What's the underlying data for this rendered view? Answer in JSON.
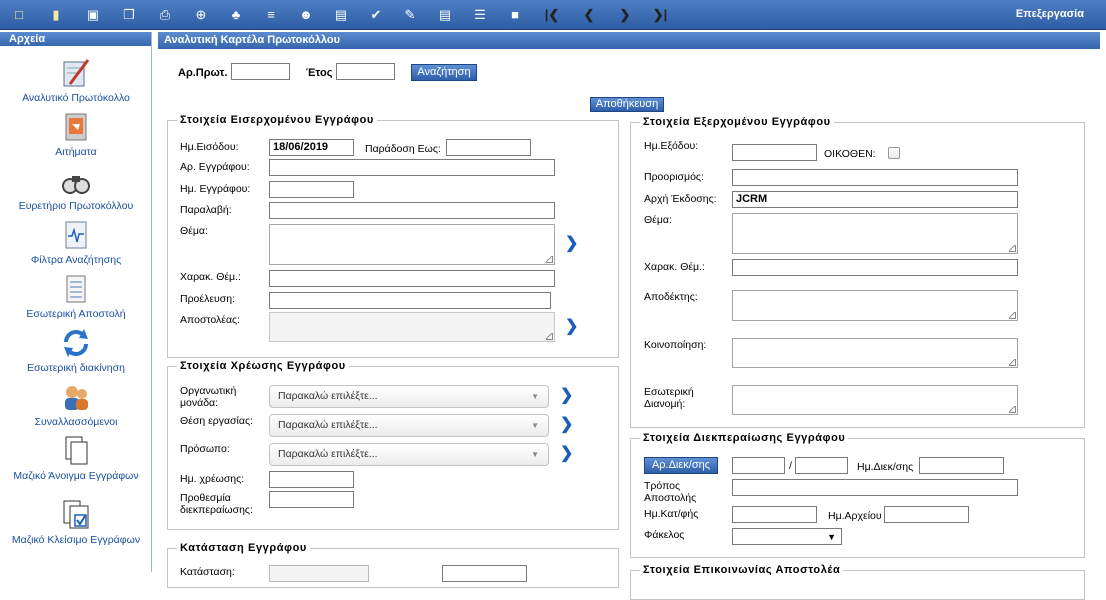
{
  "toolbar": {
    "title": "Επεξεργασία",
    "icons": [
      "new-document-icon",
      "open-folder-icon",
      "save-icon",
      "copy-icon",
      "paste-icon",
      "add-icon",
      "stamp-icon",
      "tree-icon",
      "users-icon",
      "clipboard-icon",
      "check-icon",
      "edit-icon",
      "stack-icon",
      "list-icon",
      "archive-box-icon",
      "first-page-icon",
      "previous-icon",
      "next-icon",
      "last-page-icon"
    ]
  },
  "sidebar": {
    "header": "Αρχεία",
    "items": [
      {
        "label": "Αναλυτικό Πρωτόκολλο",
        "icon": "pencil-pad-icon"
      },
      {
        "label": "Αιτήματα",
        "icon": "request-icon"
      },
      {
        "label": "Ευρετήριο Πρωτοκόλλου",
        "icon": "binoculars-icon"
      },
      {
        "label": "Φίλτρα Αναζήτησης",
        "icon": "pulse-document-icon"
      },
      {
        "label": "Εσωτερική Αποστολή",
        "icon": "notepad-icon"
      },
      {
        "label": "Εσωτερική διακίνηση",
        "icon": "refresh-arrows-icon"
      },
      {
        "label": "Συναλλασσόμενοι",
        "icon": "people-icon"
      },
      {
        "label": "Μαζικό Άνοιγμα Εγγράφων",
        "icon": "documents-icon"
      },
      {
        "label": "Μαζικό Κλείσιμο Εγγράφων",
        "icon": "documents-check-icon"
      }
    ]
  },
  "main": {
    "header": "Αναλυτική Καρτέλα Πρωτοκόλλου",
    "search": {
      "protocol_label": "Αρ.Πρωτ.",
      "protocol_value": "",
      "year_label": "Έτος",
      "year_value": "",
      "button": "Αναζήτηση"
    },
    "save_button": "Αποθήκευση",
    "incoming": {
      "title": "Στοιχεία Εισερχομένου Εγγράφου",
      "entry_date_label": "Ημ.Εισόδου:",
      "entry_date_value": "18/06/2019",
      "delivery_label": "Παράδοση Εως:",
      "doc_no_label": "Αρ. Εγγράφου:",
      "doc_date_label": "Ημ. Εγγράφου:",
      "receiver_label": "Παραλαβή:",
      "subject_label": "Θέμα:",
      "subject_char_label": "Χαρακ. Θέμ.:",
      "origin_label": "Προέλευση:",
      "sender_label": "Αποστολέας:"
    },
    "charge": {
      "title": "Στοιχεία Χρέωσης Εγγράφου",
      "org_unit_label": "Οργανωτική μονάδα:",
      "position_label": "Θέση εργασίας:",
      "person_label": "Πρόσωπο:",
      "placeholder": "Παρακαλώ επιλέξτε...",
      "charge_date_label": "Ημ. χρέωσης:",
      "deadline_label": "Προθεσμία διεκπεραίωσης:"
    },
    "status": {
      "title": "Κατάσταση Εγγράφου",
      "status_label": "Κατάσταση:"
    },
    "outgoing": {
      "title": "Στοιχεία Εξερχομένου Εγγράφου",
      "exit_date_label": "Ημ.Εξόδου:",
      "ex_officio_label": "ΟΙΚΟΘΕΝ:",
      "destination_label": "Προορισμός:",
      "issuer_label": "Αρχή Έκδοσης:",
      "issuer_value": "JCRM",
      "subject_label": "Θέμα:",
      "subject_char_label": "Χαρακ. Θέμ.:",
      "recipient_label": "Αποδέκτης:",
      "notify_label": "Κοινοποίηση:",
      "internal_label": "Εσωτερική Διανομή:"
    },
    "processing": {
      "title": "Στοιχεία Διεκπεραίωσης Εγγράφου",
      "proc_no_button": "Αρ.Διεκ/σης",
      "separator": "/",
      "proc_date_label": "Ημ.Διεκ/σης",
      "method_label": "Τρόπος Αποστολής",
      "cat_date_label": "Ημ.Κατ/φής",
      "archive_date_label": "Ημ.Αρχείου",
      "folder_label": "Φάκελος"
    },
    "contact": {
      "title": "Στοιχεία Επικοινωνίας Αποστολέα"
    }
  }
}
